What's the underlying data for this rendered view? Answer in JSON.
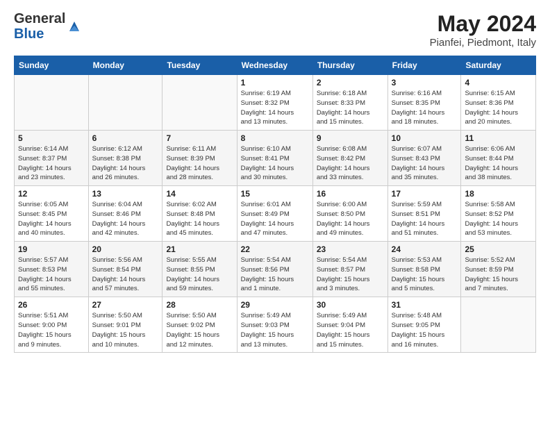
{
  "header": {
    "logo_general": "General",
    "logo_blue": "Blue",
    "month_year": "May 2024",
    "location": "Pianfei, Piedmont, Italy"
  },
  "days_of_week": [
    "Sunday",
    "Monday",
    "Tuesday",
    "Wednesday",
    "Thursday",
    "Friday",
    "Saturday"
  ],
  "weeks": [
    [
      {
        "day": "",
        "info": ""
      },
      {
        "day": "",
        "info": ""
      },
      {
        "day": "",
        "info": ""
      },
      {
        "day": "1",
        "info": "Sunrise: 6:19 AM\nSunset: 8:32 PM\nDaylight: 14 hours\nand 13 minutes."
      },
      {
        "day": "2",
        "info": "Sunrise: 6:18 AM\nSunset: 8:33 PM\nDaylight: 14 hours\nand 15 minutes."
      },
      {
        "day": "3",
        "info": "Sunrise: 6:16 AM\nSunset: 8:35 PM\nDaylight: 14 hours\nand 18 minutes."
      },
      {
        "day": "4",
        "info": "Sunrise: 6:15 AM\nSunset: 8:36 PM\nDaylight: 14 hours\nand 20 minutes."
      }
    ],
    [
      {
        "day": "5",
        "info": "Sunrise: 6:14 AM\nSunset: 8:37 PM\nDaylight: 14 hours\nand 23 minutes."
      },
      {
        "day": "6",
        "info": "Sunrise: 6:12 AM\nSunset: 8:38 PM\nDaylight: 14 hours\nand 26 minutes."
      },
      {
        "day": "7",
        "info": "Sunrise: 6:11 AM\nSunset: 8:39 PM\nDaylight: 14 hours\nand 28 minutes."
      },
      {
        "day": "8",
        "info": "Sunrise: 6:10 AM\nSunset: 8:41 PM\nDaylight: 14 hours\nand 30 minutes."
      },
      {
        "day": "9",
        "info": "Sunrise: 6:08 AM\nSunset: 8:42 PM\nDaylight: 14 hours\nand 33 minutes."
      },
      {
        "day": "10",
        "info": "Sunrise: 6:07 AM\nSunset: 8:43 PM\nDaylight: 14 hours\nand 35 minutes."
      },
      {
        "day": "11",
        "info": "Sunrise: 6:06 AM\nSunset: 8:44 PM\nDaylight: 14 hours\nand 38 minutes."
      }
    ],
    [
      {
        "day": "12",
        "info": "Sunrise: 6:05 AM\nSunset: 8:45 PM\nDaylight: 14 hours\nand 40 minutes."
      },
      {
        "day": "13",
        "info": "Sunrise: 6:04 AM\nSunset: 8:46 PM\nDaylight: 14 hours\nand 42 minutes."
      },
      {
        "day": "14",
        "info": "Sunrise: 6:02 AM\nSunset: 8:48 PM\nDaylight: 14 hours\nand 45 minutes."
      },
      {
        "day": "15",
        "info": "Sunrise: 6:01 AM\nSunset: 8:49 PM\nDaylight: 14 hours\nand 47 minutes."
      },
      {
        "day": "16",
        "info": "Sunrise: 6:00 AM\nSunset: 8:50 PM\nDaylight: 14 hours\nand 49 minutes."
      },
      {
        "day": "17",
        "info": "Sunrise: 5:59 AM\nSunset: 8:51 PM\nDaylight: 14 hours\nand 51 minutes."
      },
      {
        "day": "18",
        "info": "Sunrise: 5:58 AM\nSunset: 8:52 PM\nDaylight: 14 hours\nand 53 minutes."
      }
    ],
    [
      {
        "day": "19",
        "info": "Sunrise: 5:57 AM\nSunset: 8:53 PM\nDaylight: 14 hours\nand 55 minutes."
      },
      {
        "day": "20",
        "info": "Sunrise: 5:56 AM\nSunset: 8:54 PM\nDaylight: 14 hours\nand 57 minutes."
      },
      {
        "day": "21",
        "info": "Sunrise: 5:55 AM\nSunset: 8:55 PM\nDaylight: 14 hours\nand 59 minutes."
      },
      {
        "day": "22",
        "info": "Sunrise: 5:54 AM\nSunset: 8:56 PM\nDaylight: 15 hours\nand 1 minute."
      },
      {
        "day": "23",
        "info": "Sunrise: 5:54 AM\nSunset: 8:57 PM\nDaylight: 15 hours\nand 3 minutes."
      },
      {
        "day": "24",
        "info": "Sunrise: 5:53 AM\nSunset: 8:58 PM\nDaylight: 15 hours\nand 5 minutes."
      },
      {
        "day": "25",
        "info": "Sunrise: 5:52 AM\nSunset: 8:59 PM\nDaylight: 15 hours\nand 7 minutes."
      }
    ],
    [
      {
        "day": "26",
        "info": "Sunrise: 5:51 AM\nSunset: 9:00 PM\nDaylight: 15 hours\nand 9 minutes."
      },
      {
        "day": "27",
        "info": "Sunrise: 5:50 AM\nSunset: 9:01 PM\nDaylight: 15 hours\nand 10 minutes."
      },
      {
        "day": "28",
        "info": "Sunrise: 5:50 AM\nSunset: 9:02 PM\nDaylight: 15 hours\nand 12 minutes."
      },
      {
        "day": "29",
        "info": "Sunrise: 5:49 AM\nSunset: 9:03 PM\nDaylight: 15 hours\nand 13 minutes."
      },
      {
        "day": "30",
        "info": "Sunrise: 5:49 AM\nSunset: 9:04 PM\nDaylight: 15 hours\nand 15 minutes."
      },
      {
        "day": "31",
        "info": "Sunrise: 5:48 AM\nSunset: 9:05 PM\nDaylight: 15 hours\nand 16 minutes."
      },
      {
        "day": "",
        "info": ""
      }
    ]
  ]
}
